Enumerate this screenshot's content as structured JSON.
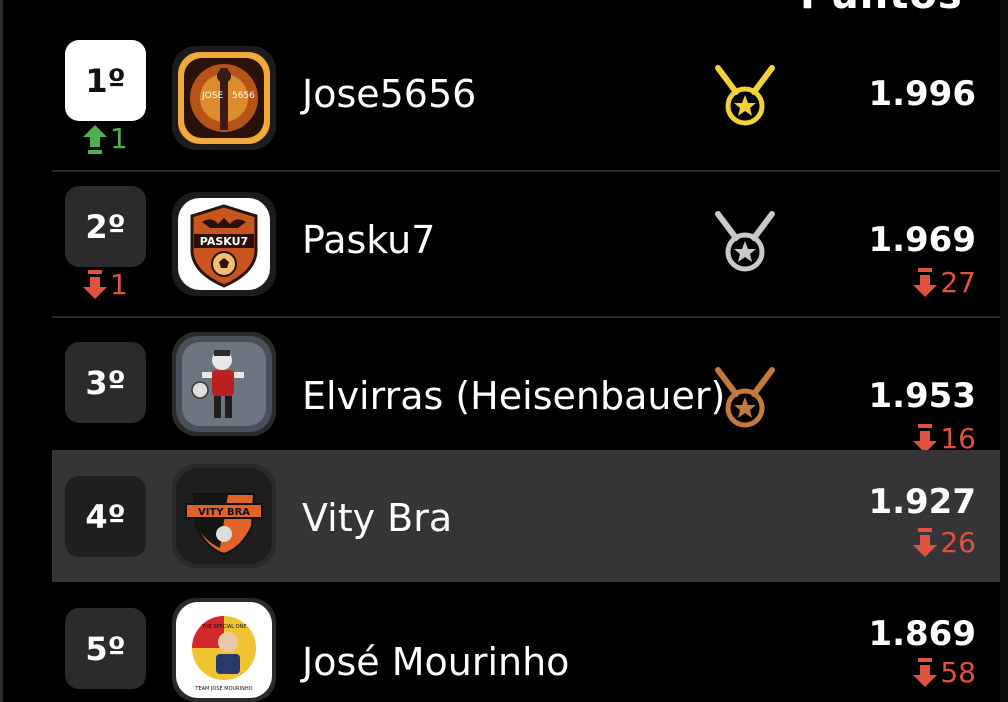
{
  "header": {
    "points_label": "Puntos"
  },
  "rows": [
    {
      "position": "1º",
      "change": {
        "direction": "up",
        "value": "1"
      },
      "avatar_icon": "team-crest-flame-icon",
      "name": "Jose5656",
      "medal": "gold",
      "points": "1.996",
      "points_change": null
    },
    {
      "position": "2º",
      "change": {
        "direction": "down",
        "value": "1"
      },
      "avatar_icon": "team-crest-pasku7-icon",
      "name": "Pasku7",
      "medal": "silver",
      "points": "1.969",
      "points_change": {
        "direction": "down",
        "value": "27"
      }
    },
    {
      "position": "3º",
      "change": null,
      "avatar_icon": "team-crest-skeleton-player-icon",
      "name": "Elvirras (Heisenbauer)",
      "medal": "bronze",
      "points": "1.953",
      "points_change": {
        "direction": "down",
        "value": "16"
      }
    },
    {
      "position": "4º",
      "change": null,
      "avatar_icon": "team-crest-vity-bra-icon",
      "name": "Vity Bra",
      "medal": null,
      "points": "1.927",
      "points_change": {
        "direction": "down",
        "value": "26"
      },
      "highlighted": true
    },
    {
      "position": "5º",
      "change": null,
      "avatar_icon": "team-crest-mourinho-icon",
      "name": "José Mourinho",
      "medal": null,
      "points": "1.869",
      "points_change": {
        "direction": "down",
        "value": "58"
      }
    }
  ],
  "colors": {
    "gold": "#f2d23a",
    "silver": "#c9c9c9",
    "bronze": "#c27a3e",
    "up": "#4fb04f",
    "down": "#e0513e",
    "highlight_row": "#353538"
  }
}
